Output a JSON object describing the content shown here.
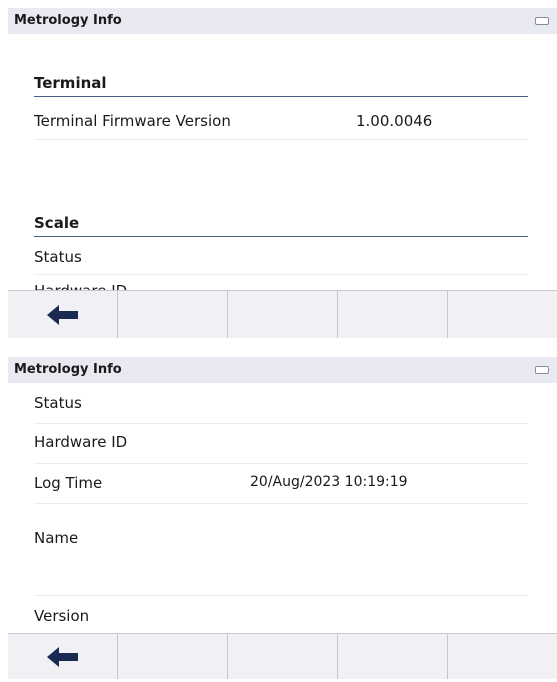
{
  "screen1": {
    "title": "Metrology Info",
    "sections": {
      "terminal": "Terminal",
      "scale": "Scale"
    },
    "rows": {
      "firmware_label": "Terminal Firmware Version",
      "firmware_value": "1.00.0046",
      "status_label": "Status"
    }
  },
  "screen2": {
    "title": "Metrology Info",
    "rows": {
      "status_label": "Status",
      "hardware_label": "Hardware ID",
      "log_label": "Log Time",
      "log_value": "20/Aug/2023 10:19:19",
      "name_label": "Name",
      "version_label": "Version"
    }
  },
  "icons": {
    "battery": "battery-icon",
    "back": "left-arrow-icon"
  },
  "colors": {
    "titlebar": "#e9e9f2",
    "accent_line": "#4a5a84",
    "softkey_bg": "#f0f0f5"
  }
}
